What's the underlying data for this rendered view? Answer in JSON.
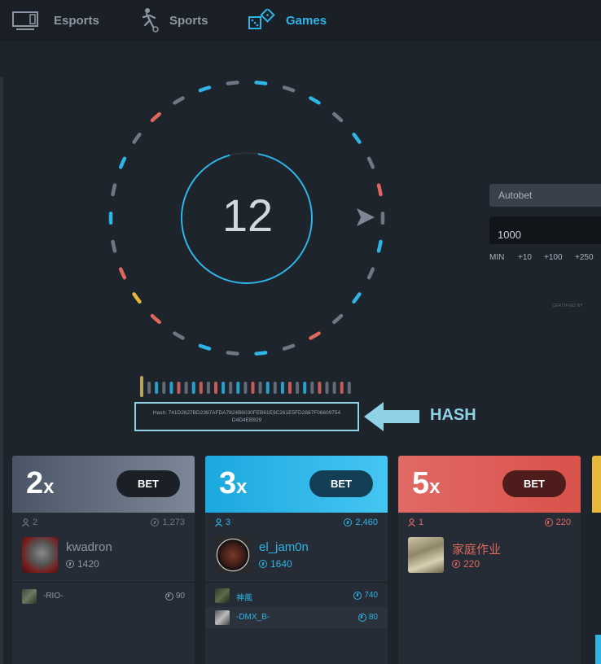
{
  "nav": {
    "items": [
      {
        "label": "Esports",
        "icon": "monitor-icon"
      },
      {
        "label": "Sports",
        "icon": "soccer-player-icon"
      },
      {
        "label": "Games",
        "icon": "dice-icon",
        "active": true
      }
    ]
  },
  "wheel": {
    "countdown": "12"
  },
  "hash": {
    "text_line1": "Hash: 741D2627BD2397AFDA7824B6030FEB61E9C261E5FD2887F06609754",
    "text_line2": "D4D4EB929",
    "callout": "HASH"
  },
  "bet_panel": {
    "mode": "Autobet",
    "amount": "1000",
    "quick_buttons": [
      "MIN",
      "+10",
      "+100",
      "+250"
    ],
    "certified_label": "CERTIFIED BY"
  },
  "columns": [
    {
      "multiplier": "2",
      "suffix": "x",
      "bet_label": "BET",
      "player_count": "2",
      "total": "1,273",
      "top": {
        "name": "kwadron",
        "amount": "1420"
      },
      "rows": [
        {
          "name": "-RIO-",
          "amount": "90"
        }
      ]
    },
    {
      "multiplier": "3",
      "suffix": "x",
      "bet_label": "BET",
      "player_count": "3",
      "total": "2,460",
      "top": {
        "name": "el_jam0n",
        "amount": "1640"
      },
      "rows": [
        {
          "name": "神風",
          "amount": "740"
        },
        {
          "name": "-DMX_B-",
          "amount": "80"
        }
      ]
    },
    {
      "multiplier": "5",
      "suffix": "x",
      "bet_label": "BET",
      "player_count": "1",
      "total": "220",
      "top": {
        "name": "家庭作业",
        "amount": "220"
      },
      "rows": []
    }
  ],
  "colors": {
    "accent": "#2fb4e6",
    "grey": "#6d7785",
    "red": "#e0675f",
    "gold": "#e8b83a",
    "hash_highlight": "#8fd2e5"
  }
}
